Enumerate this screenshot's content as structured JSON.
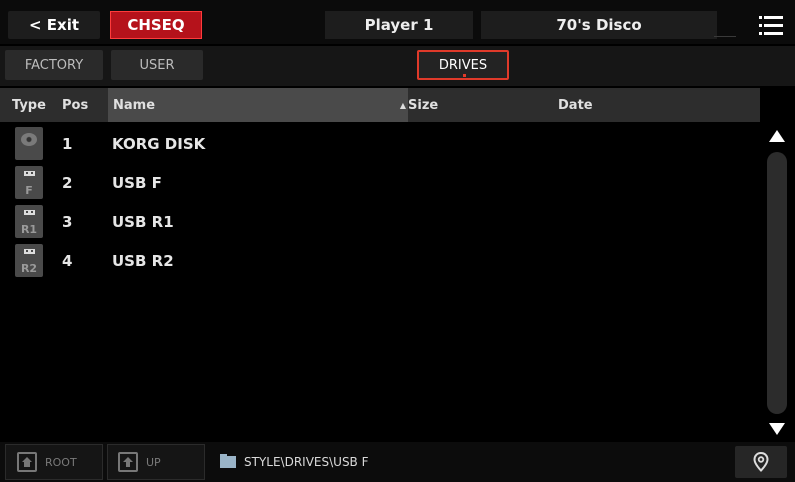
{
  "topbar": {
    "exit_label": "< Exit",
    "mode_label": "CHSEQ",
    "player_label": "Player 1",
    "style_name": "70's Disco",
    "menu_icon": "hamburger-menu-icon"
  },
  "tabs": {
    "factory_label": "FACTORY",
    "user_label": "USER",
    "drives_label": "DRIVES",
    "active": "DRIVES"
  },
  "table": {
    "columns": {
      "type": "Type",
      "pos": "Pos",
      "name": "Name",
      "size": "Size",
      "date": "Date"
    },
    "sort_column": "Name",
    "sort_direction": "ascending",
    "rows": [
      {
        "type_icon": "disk-icon",
        "type_label": "",
        "pos": "1",
        "name": "KORG DISK",
        "size": "",
        "date": ""
      },
      {
        "type_icon": "usb-drive-icon",
        "type_label": "F",
        "pos": "2",
        "name": "USB F",
        "size": "",
        "date": ""
      },
      {
        "type_icon": "usb-drive-icon",
        "type_label": "R1",
        "pos": "3",
        "name": "USB R1",
        "size": "",
        "date": ""
      },
      {
        "type_icon": "usb-drive-icon",
        "type_label": "R2",
        "pos": "4",
        "name": "USB R2",
        "size": "",
        "date": ""
      }
    ]
  },
  "bottombar": {
    "root_label": "ROOT",
    "up_label": "UP",
    "path": "STYLE\\DRIVES\\USB F",
    "location_icon": "location-pin-icon"
  },
  "colors": {
    "accent_red": "#b5121b",
    "active_border": "#e03a2a",
    "header_bg": "#2d2d2d",
    "sorted_header_bg": "#4a4a4a"
  }
}
